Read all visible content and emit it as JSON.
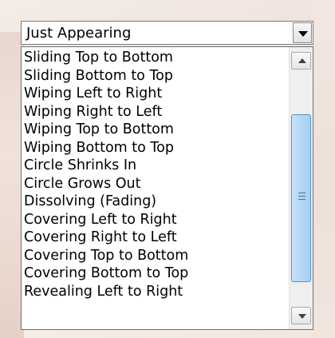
{
  "combo": {
    "selected_value": "Just Appearing",
    "dropdown_icon": "chevron-down-icon"
  },
  "list": {
    "items": [
      "Sliding Top to Bottom",
      "Sliding Bottom to Top",
      "Wiping Left to Right",
      "Wiping Right to Left",
      "Wiping Top to Bottom",
      "Wiping Bottom to Top",
      "Circle Shrinks In",
      "Circle Grows Out",
      "Dissolving (Fading)",
      "Covering Left to Right",
      "Covering Right to Left",
      "Covering Top to Bottom",
      "Covering Bottom to Top",
      "Revealing Left to Right"
    ]
  },
  "scrollbar": {
    "up_icon": "scroll-up-arrow-icon",
    "down_icon": "scroll-down-arrow-icon"
  }
}
